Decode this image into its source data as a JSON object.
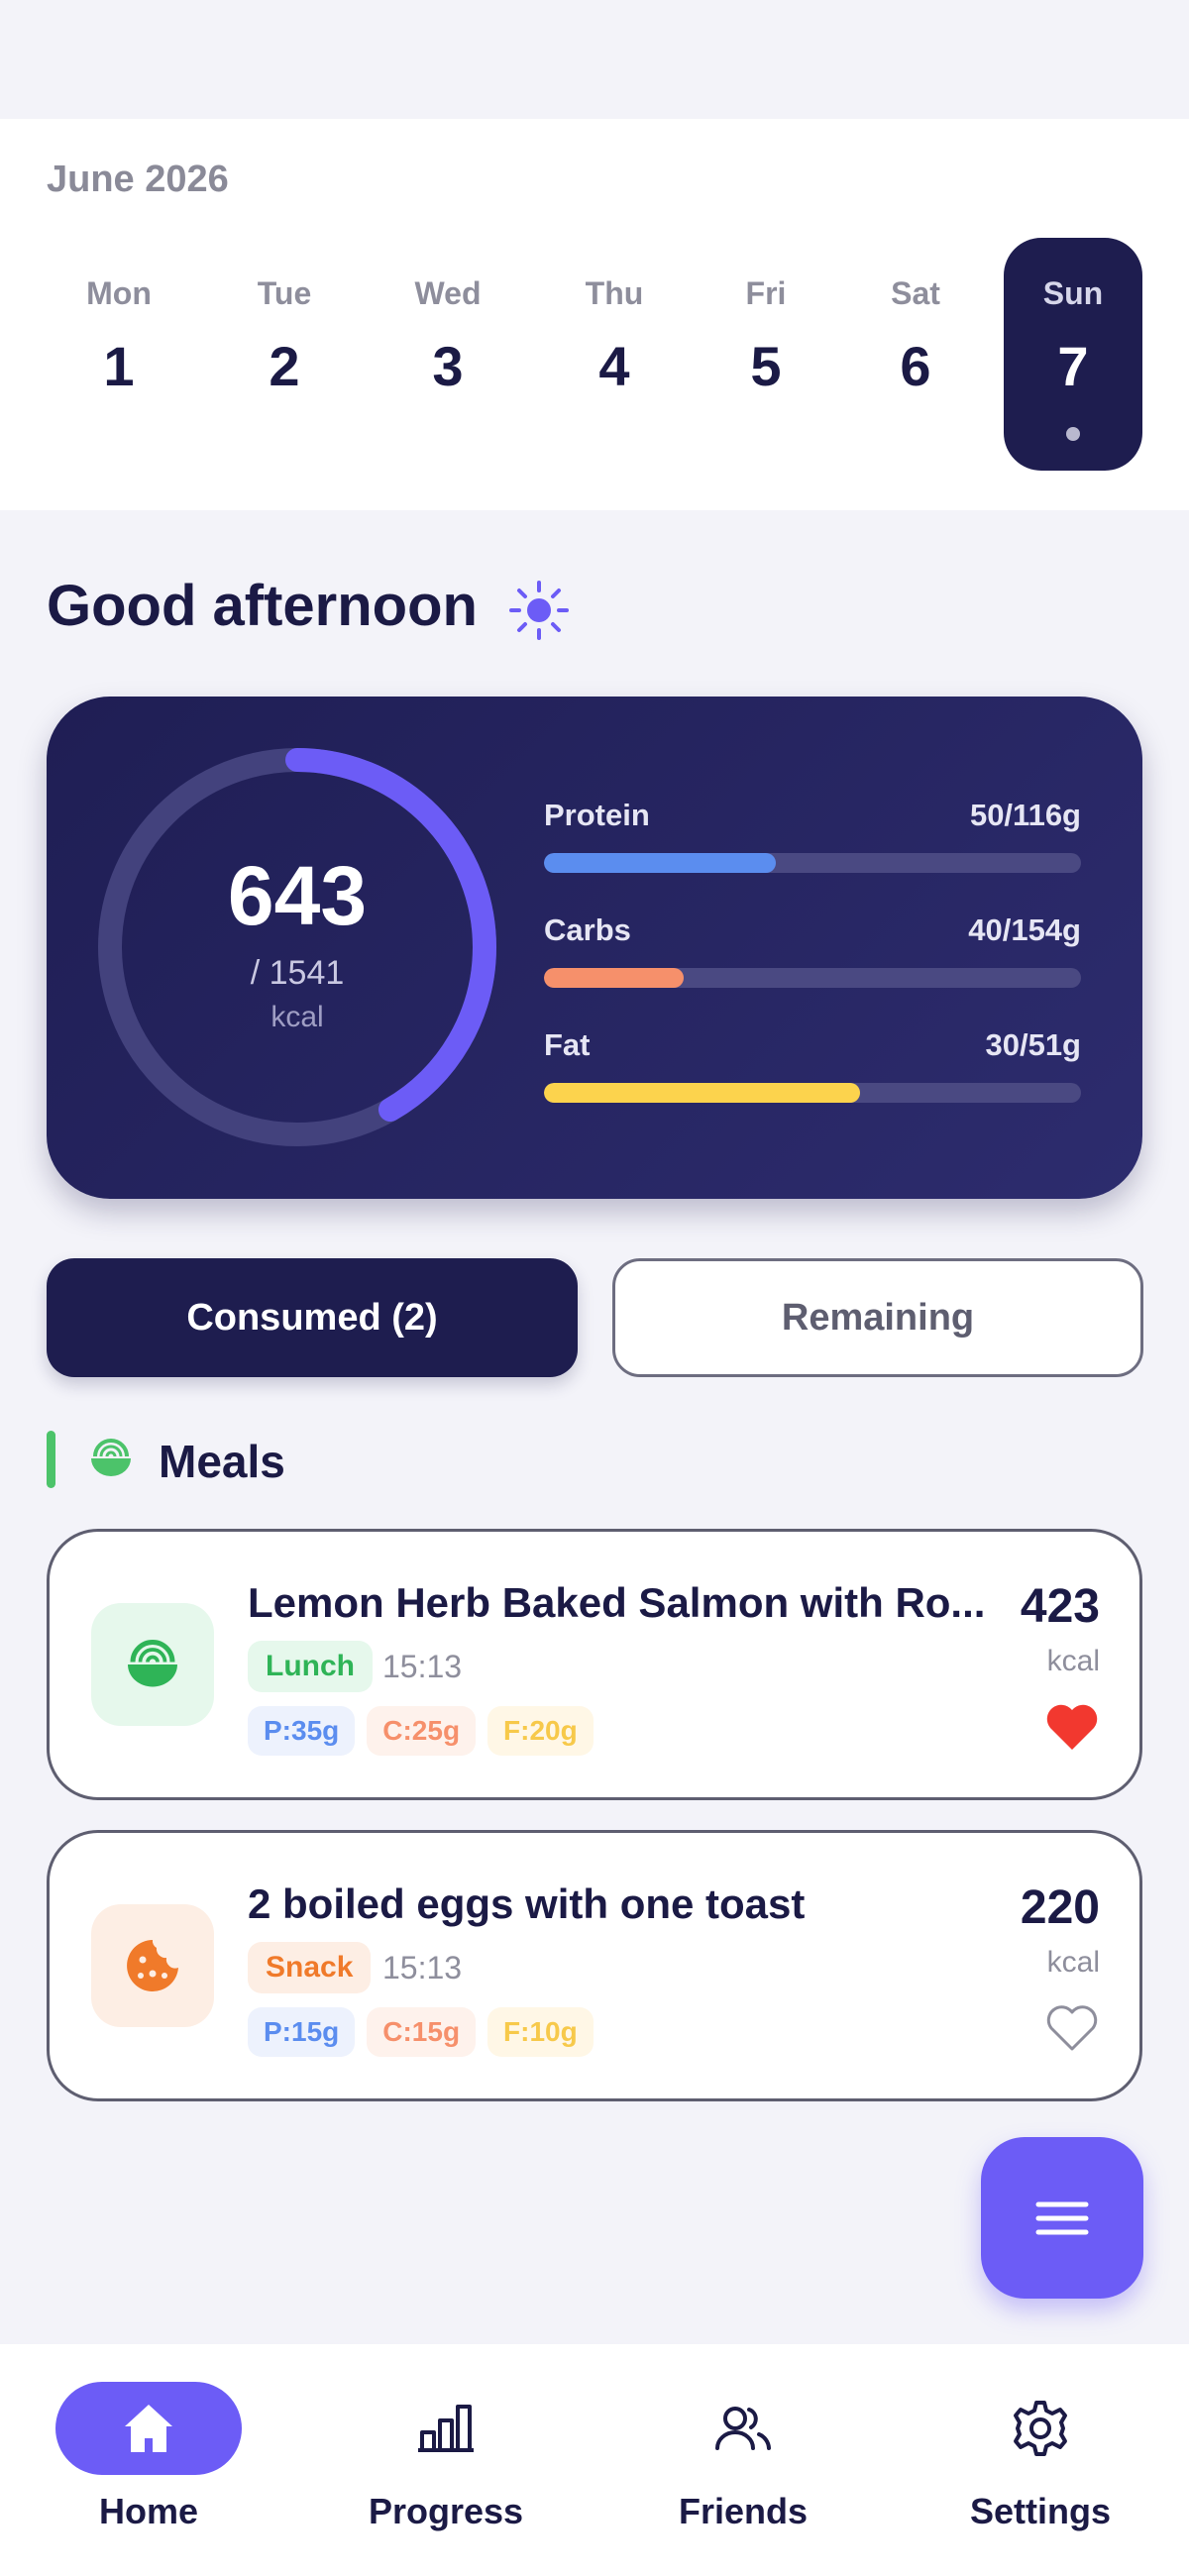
{
  "calendar": {
    "month_label": "June 2026",
    "days": [
      {
        "dow": "Mon",
        "num": "1"
      },
      {
        "dow": "Tue",
        "num": "2"
      },
      {
        "dow": "Wed",
        "num": "3"
      },
      {
        "dow": "Thu",
        "num": "4"
      },
      {
        "dow": "Fri",
        "num": "5"
      },
      {
        "dow": "Sat",
        "num": "6"
      },
      {
        "dow": "Sun",
        "num": "7",
        "selected": true
      }
    ]
  },
  "greeting": {
    "text": "Good afternoon",
    "icon": "sun-icon"
  },
  "summary": {
    "consumed_kcal": "643",
    "goal_label": "/ 1541",
    "unit": "kcal",
    "ring_progress": 0.417,
    "macros": [
      {
        "name": "Protein",
        "value": "50/116g",
        "progress": 0.431,
        "color": "#5B8DEF"
      },
      {
        "name": "Carbs",
        "value": "40/154g",
        "progress": 0.26,
        "color": "#F6906B"
      },
      {
        "name": "Fat",
        "value": "30/51g",
        "progress": 0.588,
        "color": "#FCD34D"
      }
    ]
  },
  "tabs": {
    "consumed_label": "Consumed (2)",
    "remaining_label": "Remaining",
    "active": "consumed"
  },
  "meals_section": {
    "title": "Meals",
    "icon": "bowl-icon"
  },
  "meals": [
    {
      "name": "Lemon Herb Baked Salmon with Ro...",
      "tag": "Lunch",
      "time": "15:13",
      "protein": "P:35g",
      "carbs": "C:25g",
      "fat": "F:20g",
      "kcal": "423",
      "unit": "kcal",
      "favorite": true,
      "icon": "bowl-icon"
    },
    {
      "name": "2 boiled eggs with one toast",
      "tag": "Snack",
      "time": "15:13",
      "protein": "P:15g",
      "carbs": "C:15g",
      "fat": "F:10g",
      "kcal": "220",
      "unit": "kcal",
      "favorite": false,
      "icon": "cookie-icon"
    }
  ],
  "fab": {
    "icon": "menu-icon"
  },
  "nav": [
    {
      "label": "Home",
      "icon": "home-icon",
      "active": true
    },
    {
      "label": "Progress",
      "icon": "bar-chart-icon"
    },
    {
      "label": "Friends",
      "icon": "users-icon"
    },
    {
      "label": "Settings",
      "icon": "gear-icon"
    }
  ],
  "colors": {
    "primary_dark": "#1E1D4F",
    "accent": "#6C5CF6",
    "green": "#4CC36A",
    "favorite_red": "#F2382F",
    "background": "#F3F3F9"
  }
}
